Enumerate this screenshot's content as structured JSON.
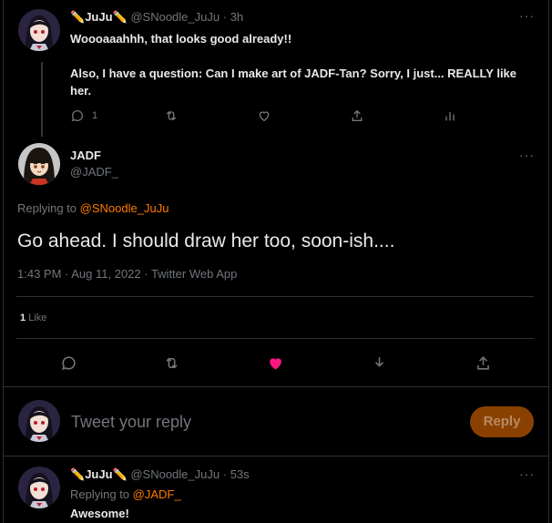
{
  "tweet1": {
    "display_name": "JuJu",
    "handle": "@SNoodle_JuJu",
    "time_sep": "·",
    "time": "3h",
    "body_line1": "Woooaaahhh, that looks good already!!",
    "body_line2": "Also, I have a question: Can I make art of JADF-Tan? Sorry, I just... REALLY like",
    "body_line3": "her.",
    "reply_count": "1"
  },
  "main_tweet": {
    "display_name": "JADF",
    "handle": "@JADF_",
    "replying_prefix": "Replying to",
    "replying_to": "@SNoodle_JuJu",
    "text": "Go ahead. I should draw her too, soon-ish....",
    "timestamp": "1:43 PM · Aug 11, 2022 · Twitter Web App",
    "likes_count": "1",
    "likes_label": "Like"
  },
  "composer": {
    "placeholder": "Tweet your reply",
    "reply_button": "Reply"
  },
  "tweet3": {
    "display_name": "JuJu",
    "handle": "@SNoodle_JuJu",
    "time_sep": "·",
    "time": "53s",
    "replying_prefix": "Replying to",
    "replying_to": "@JADF_",
    "text": "Awesome!"
  },
  "colors": {
    "accent": "#ff7a00",
    "liked": "#f91880",
    "reply_button_bg": "#8a4100"
  },
  "icons": [
    "reply-icon",
    "retweet-icon",
    "like-icon",
    "share-icon",
    "analytics-icon",
    "download-icon",
    "more-icon"
  ]
}
